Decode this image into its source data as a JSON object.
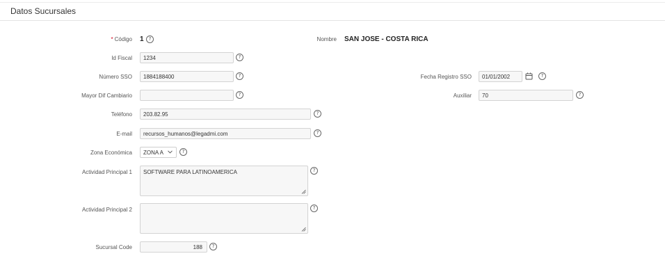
{
  "header": {
    "title": "Datos Sucursales"
  },
  "help_glyph": "?",
  "form": {
    "codigo": {
      "label": "Código",
      "value": "1"
    },
    "nombre": {
      "label": "Nombre",
      "value": "SAN JOSE - COSTA RICA"
    },
    "id_fiscal": {
      "label": "Id Fiscal",
      "value": "1234"
    },
    "numero_sso": {
      "label": "Número SSO",
      "value": "1884188400"
    },
    "fecha_registro_sso": {
      "label": "Fecha Registro SSO",
      "value": "01/01/2002"
    },
    "mayor_dif_cambiario": {
      "label": "Mayor Dif Cambiario",
      "value": ""
    },
    "auxiliar": {
      "label": "Auxiliar",
      "value": "70"
    },
    "telefono": {
      "label": "Teléfono",
      "value": "203.82.95"
    },
    "email": {
      "label": "E-mail",
      "value": "recursos_humanos@legadmi.com"
    },
    "zona_economica": {
      "label": "Zona Económica",
      "value": "ZONA A"
    },
    "actividad_principal_1": {
      "label": "Actividad Principal 1",
      "value": "SOFTWARE PARA LATINOAMERICA"
    },
    "actividad_principal_2": {
      "label": "Actividad Principal 2",
      "value": ""
    },
    "sucursal_code": {
      "label": "Sucursal Code",
      "value": "188"
    }
  }
}
